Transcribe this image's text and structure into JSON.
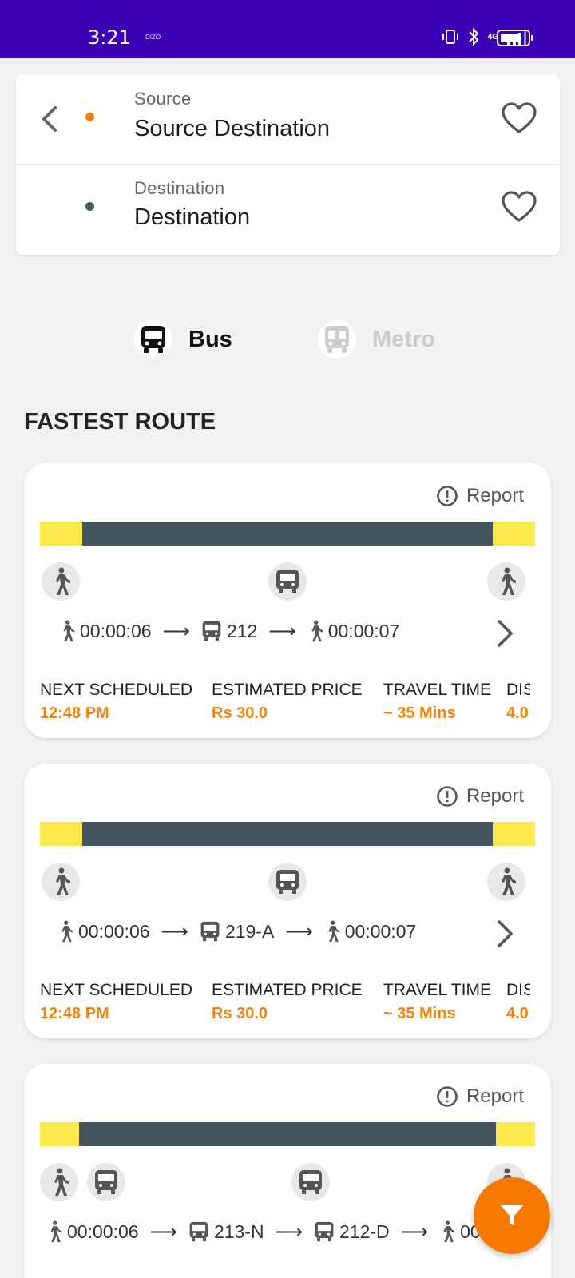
{
  "status_bar": {
    "time": "3:21",
    "brand": "DIZO",
    "network": "4G"
  },
  "source": {
    "label": "Source",
    "value": "Source Destination",
    "dot_color": "#f57c00"
  },
  "destination": {
    "label": "Destination",
    "value": "Destination",
    "dot_color": "#455a64"
  },
  "modes": [
    {
      "label": "Bus",
      "icon": "bus-icon",
      "active": true
    },
    {
      "label": "Metro",
      "icon": "metro-icon",
      "active": false
    }
  ],
  "section_title": "FASTEST ROUTE",
  "report_label": "Report",
  "headers": {
    "next": "NEXT SCHEDULED",
    "price": "ESTIMATED PRICE",
    "travel": "TRAVEL TIME",
    "distance": "DIS"
  },
  "routes": [
    {
      "steps": [
        {
          "icon": "walk-icon",
          "text": "00:00:06"
        },
        {
          "icon": "bus-icon",
          "text": "212"
        },
        {
          "icon": "walk-icon",
          "text": "00:00:07"
        }
      ],
      "next_scheduled": "12:48 PM",
      "estimated_price": "Rs 30.0",
      "travel_time": "~ 35 Mins",
      "distance": "4.0"
    },
    {
      "steps": [
        {
          "icon": "walk-icon",
          "text": "00:00:06"
        },
        {
          "icon": "bus-icon",
          "text": "219-A"
        },
        {
          "icon": "walk-icon",
          "text": "00:00:07"
        }
      ],
      "next_scheduled": "12:48 PM",
      "estimated_price": "Rs 30.0",
      "travel_time": "~ 35 Mins",
      "distance": "4.0"
    },
    {
      "steps": [
        {
          "icon": "walk-icon",
          "text": "00:00:06"
        },
        {
          "icon": "bus-icon",
          "text": "213-N"
        },
        {
          "icon": "bus-icon",
          "text": "212-D"
        },
        {
          "icon": "walk-icon",
          "text": "00:0"
        }
      ]
    }
  ],
  "colors": {
    "status_bar": "#3b00b5",
    "accent": "#f77a00",
    "segment_walk": "#fbe84a",
    "segment_bus": "#455560"
  }
}
